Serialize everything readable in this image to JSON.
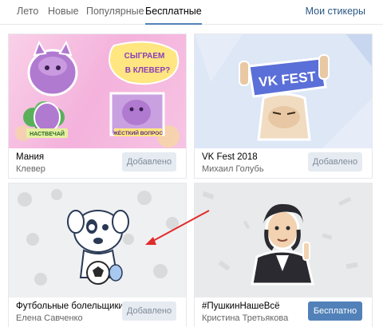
{
  "tabs": [
    {
      "label": "Лето"
    },
    {
      "label": "Новые"
    },
    {
      "label": "Популярные"
    },
    {
      "label": "Бесплатные"
    }
  ],
  "active_tab": "Бесплатные",
  "my_stickers": "Мои стикеры",
  "cards": [
    {
      "title": "Мания",
      "author": "Клевер",
      "button": "Добавлено",
      "preview_text": [
        "СЫГРАЕМ",
        "В КЛЕВЕР?",
        "НАСТВЕЧАЙ",
        "ЖЁСТКИЙ ВОПРОС"
      ]
    },
    {
      "title": "VK Fest 2018",
      "author": "Михаил Голубь",
      "button": "Добавлено",
      "preview_text": [
        "VK FEST"
      ]
    },
    {
      "title": "Футбольные болельщики",
      "author": "Елена Савченко",
      "button": "Добавлено"
    },
    {
      "title": "#ПушкинНашеВсё",
      "author": "Кристина Третьякова",
      "button": "Бесплатно"
    }
  ],
  "colors": {
    "accent": "#5181b8",
    "link": "#2a5885",
    "annotation_arrow": "#e02b2b"
  }
}
